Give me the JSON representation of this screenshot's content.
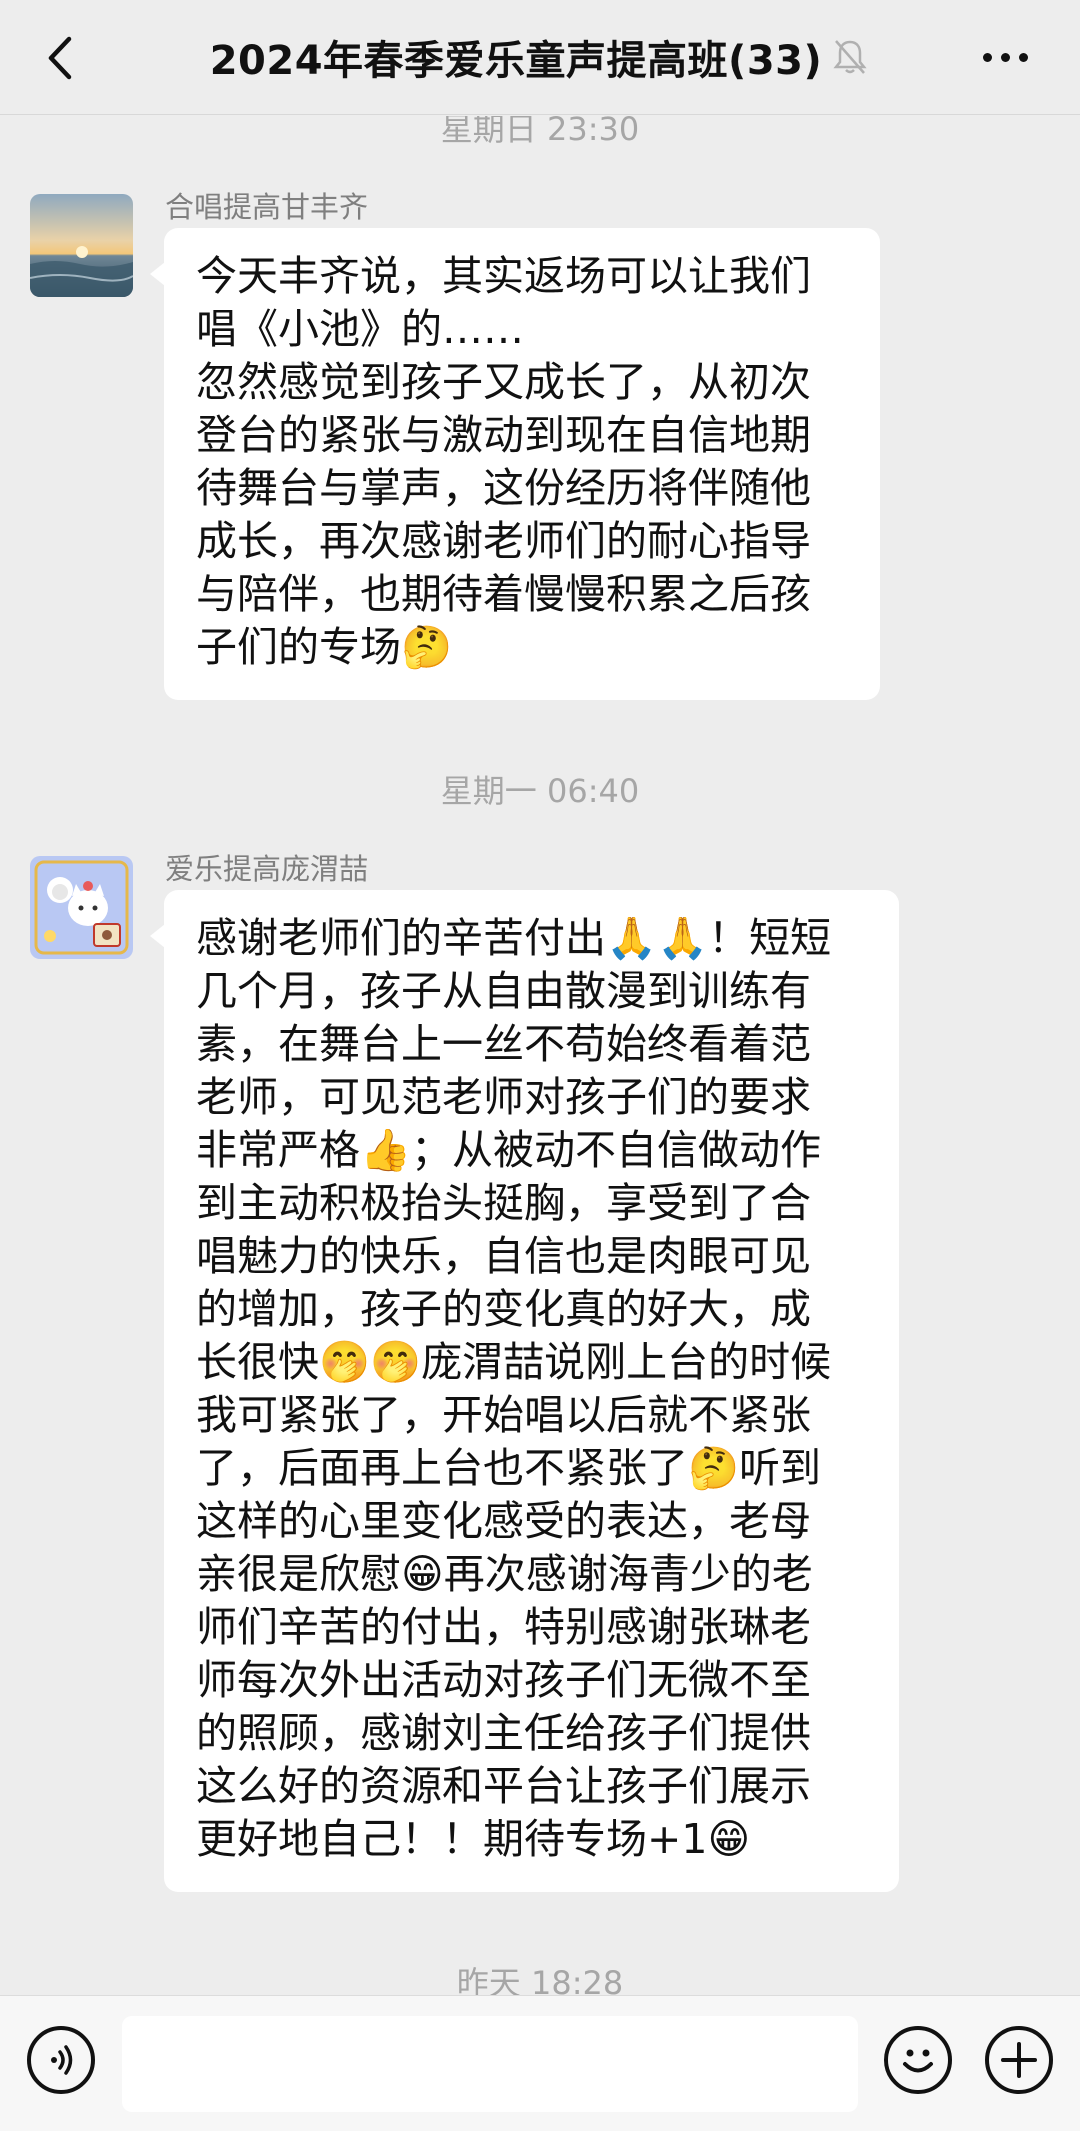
{
  "header": {
    "title": "2024年春季爱乐童声提高班(33)",
    "back_icon": "chevron-left-icon",
    "mute_icon": "bell-muted-icon",
    "more_icon": "more-horizontal-icon"
  },
  "messages": [
    {
      "time": "星期日 23:30",
      "sender": "合唱提高甘丰齐",
      "avatar": "sunset-sea-avatar",
      "text": "今天丰齐说，其实返场可以让我们\n唱《小池》的……\n忽然感觉到孩子又成长了，从初次\n登台的紧张与激动到现在自信地期\n待舞台与掌声，这份经历将伴随他\n成长，再次感谢老师们的耐心指导\n与陪伴，也期待着慢慢积累之后孩\n子们的专场🤔"
    },
    {
      "time": "星期一 06:40",
      "sender": "爱乐提高庞渭喆",
      "avatar": "cartoon-cat-avatar",
      "text": "感谢老师们的辛苦付出🙏🙏！短短\n几个月，孩子从自由散漫到训练有\n素，在舞台上一丝不苟始终看着范\n老师，可见范老师对孩子们的要求\n非常严格👍；从被动不自信做动作\n到主动积极抬头挺胸，享受到了合\n唱魅力的快乐，自信也是肉眼可见\n的增加，孩子的变化真的好大，成\n长很快🤭🤭庞渭喆说刚上台的时候\n我可紧张了，开始唱以后就不紧张\n了，后面再上台也不紧张了🤔听到\n这样的心里变化感受的表达，老母\n亲很是欣慰😁再次感谢海青少的老\n师们辛苦的付出，特别感谢张琳老\n师每次外出活动对孩子们无微不至\n的照顾，感谢刘主任给孩子们提供\n这么好的资源和平台让孩子们展示\n更好地自己！！期待专场+1😁"
    }
  ],
  "next_time": "昨天 18:28",
  "bottombar": {
    "voice_icon": "voice-icon",
    "emoji_icon": "emoji-icon",
    "plus_icon": "plus-icon"
  }
}
